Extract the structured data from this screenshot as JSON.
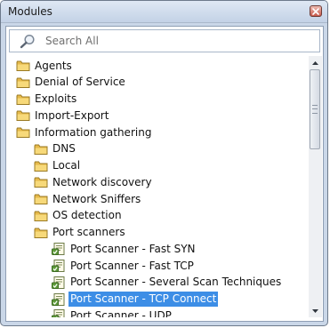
{
  "window": {
    "title": "Modules"
  },
  "search": {
    "placeholder": "Search All"
  },
  "tree": [
    {
      "label": "Agents",
      "type": "folder",
      "level": 0
    },
    {
      "label": "Denial of Service",
      "type": "folder",
      "level": 0
    },
    {
      "label": "Exploits",
      "type": "folder",
      "level": 0
    },
    {
      "label": "Import-Export",
      "type": "folder",
      "level": 0
    },
    {
      "label": "Information gathering",
      "type": "folder",
      "level": 0
    },
    {
      "label": "DNS",
      "type": "folder",
      "level": 1
    },
    {
      "label": "Local",
      "type": "folder",
      "level": 1
    },
    {
      "label": "Network discovery",
      "type": "folder",
      "level": 1
    },
    {
      "label": "Network Sniffers",
      "type": "folder",
      "level": 1
    },
    {
      "label": "OS detection",
      "type": "folder",
      "level": 1
    },
    {
      "label": "Port scanners",
      "type": "folder",
      "level": 1
    },
    {
      "label": "Port Scanner - Fast SYN",
      "type": "module",
      "level": 2
    },
    {
      "label": "Port Scanner - Fast TCP",
      "type": "module",
      "level": 2
    },
    {
      "label": "Port Scanner - Several Scan Techniques",
      "type": "module",
      "level": 2
    },
    {
      "label": "Port Scanner - TCP Connect",
      "type": "module",
      "level": 2,
      "selected": true
    },
    {
      "label": "Port Scanner - UDP",
      "type": "module",
      "level": 2
    }
  ],
  "colors": {
    "selection": "#3d8ee6",
    "folder": "#f2c94c",
    "module_icon": "#6aa84f"
  },
  "icons": {
    "folder": "folder-icon",
    "module": "module-script-icon",
    "search": "magnifier-icon",
    "close": "close-icon"
  }
}
